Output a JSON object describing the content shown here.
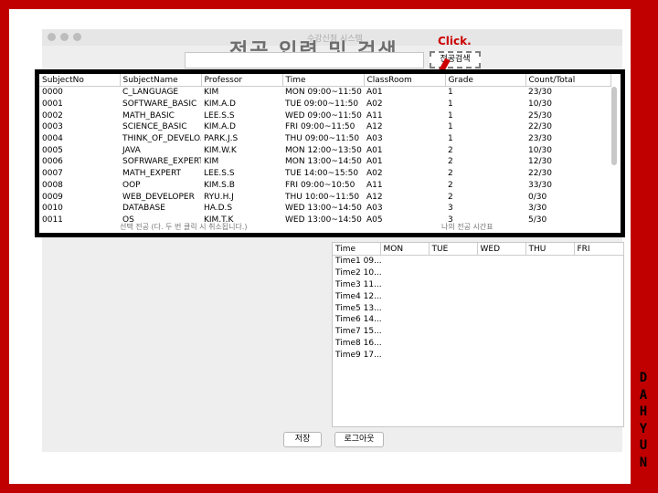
{
  "window": {
    "title": "수강신청 시스템",
    "heading": "전공 입력 및 검색",
    "search_button": "전공검색",
    "search_value": ""
  },
  "annotation": {
    "click_label": "Click.",
    "arrow_color": "#cc0000",
    "side_text": [
      "D",
      "A",
      "H",
      "Y",
      "U",
      "N"
    ]
  },
  "subjects_table": {
    "headers": [
      "SubjectNo",
      "SubjectName",
      "Professor",
      "Time",
      "ClassRoom",
      "Grade",
      "Count/Total"
    ],
    "rows": [
      [
        "0000",
        "C_LANGUAGE",
        "KIM",
        "MON 09:00~11:50",
        "A01",
        "1",
        "23/30"
      ],
      [
        "0001",
        "SOFTWARE_BASIC",
        "KIM.A.D",
        "TUE 09:00~11:50",
        "A02",
        "1",
        "10/30"
      ],
      [
        "0002",
        "MATH_BASIC",
        "LEE.S.S",
        "WED 09:00~11:50",
        "A11",
        "1",
        "25/30"
      ],
      [
        "0003",
        "SCIENCE_BASIC",
        "KIM.A.D",
        "FRI 09:00~11:50",
        "A12",
        "1",
        "22/30"
      ],
      [
        "0004",
        "THINK_OF_DEVELO...",
        "PARK.J.S",
        "THU 09:00~11:50",
        "A03",
        "1",
        "23/30"
      ],
      [
        "0005",
        "JAVA",
        "KIM.W.K",
        "MON 12:00~13:50",
        "A01",
        "2",
        "10/30"
      ],
      [
        "0006",
        "SOFRWARE_EXPERT",
        "KIM",
        "MON 13:00~14:50",
        "A01",
        "2",
        "12/30"
      ],
      [
        "0007",
        "MATH_EXPERT",
        "LEE.S.S",
        "TUE 14:00~15:50",
        "A02",
        "2",
        "22/30"
      ],
      [
        "0008",
        "OOP",
        "KIM.S.B",
        "FRI 09:00~10:50",
        "A11",
        "2",
        "33/30"
      ],
      [
        "0009",
        "WEB_DEVELOPER",
        "RYU.H.J",
        "THU 10:00~11:50",
        "A12",
        "2",
        "0/30"
      ],
      [
        "0010",
        "DATABASE",
        "HA.D.S",
        "WED 13:00~14:50",
        "A03",
        "3",
        "3/30"
      ],
      [
        "0011",
        "OS",
        "KIM.T.K",
        "WED 13:00~14:50",
        "A05",
        "3",
        "5/30"
      ]
    ],
    "selection_hint": "선택 전공 (다. 두 번 클릭 시 취소됩니다.)",
    "my_timetable_hint": "나의 전공 시간표"
  },
  "timetable": {
    "headers": [
      "Time",
      "MON",
      "TUE",
      "WED",
      "THU",
      "FRI"
    ],
    "rows": [
      "Time1 09...",
      "Time2 10...",
      "Time3 11...",
      "Time4 12...",
      "Time5 13...",
      "Time6 14...",
      "Time7 15...",
      "Time8 16...",
      "Time9 17..."
    ]
  },
  "buttons": {
    "save": "저장",
    "logout": "로그아웃"
  }
}
